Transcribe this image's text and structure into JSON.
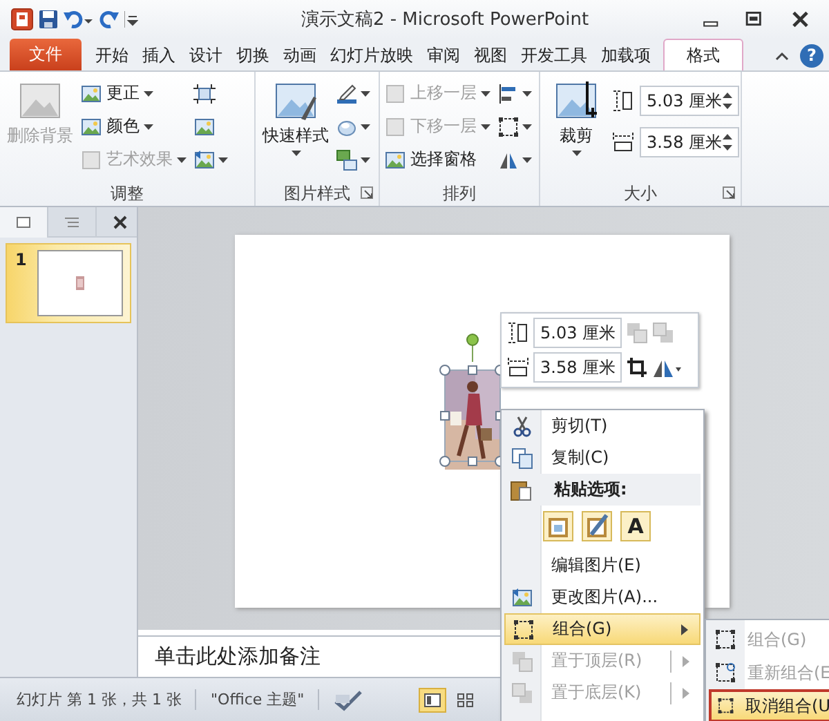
{
  "window": {
    "title": "演示文稿2  -  Microsoft PowerPoint"
  },
  "ribbon_tabs": [
    {
      "label": "文件",
      "kind": "file",
      "selected": false
    },
    {
      "label": "开始",
      "kind": "tab",
      "selected": false
    },
    {
      "label": "插入",
      "kind": "tab",
      "selected": false
    },
    {
      "label": "设计",
      "kind": "tab",
      "selected": false
    },
    {
      "label": "切换",
      "kind": "tab",
      "selected": false
    },
    {
      "label": "动画",
      "kind": "tab",
      "selected": false
    },
    {
      "label": "幻灯片放映",
      "kind": "tab",
      "selected": false
    },
    {
      "label": "审阅",
      "kind": "tab",
      "selected": false
    },
    {
      "label": "视图",
      "kind": "tab",
      "selected": false
    },
    {
      "label": "开发工具",
      "kind": "tab",
      "selected": false
    },
    {
      "label": "加载项",
      "kind": "tab",
      "selected": false
    },
    {
      "label": "格式",
      "kind": "tab",
      "selected": true
    }
  ],
  "help": {
    "label": "?"
  },
  "ribbon_groups": [
    {
      "label": "调整",
      "launcher": false,
      "buttons": [
        {
          "kind": "large",
          "label": "删除背景",
          "disabled": true,
          "dropdown": false
        },
        {
          "kind": "small",
          "label": "更正",
          "disabled": false,
          "dropdown": true
        },
        {
          "kind": "small",
          "label": "颜色",
          "disabled": false,
          "dropdown": true
        },
        {
          "kind": "small",
          "label": "艺术效果",
          "disabled": true,
          "dropdown": true
        },
        {
          "kind": "icon",
          "disabled": false,
          "dropdown": false
        },
        {
          "kind": "icon",
          "disabled": false,
          "dropdown": false
        },
        {
          "kind": "icon",
          "disabled": false,
          "dropdown": true
        }
      ]
    },
    {
      "label": "图片样式",
      "launcher": true,
      "buttons": [
        {
          "kind": "large",
          "label": "快速样式",
          "disabled": false,
          "dropdown": true
        },
        {
          "kind": "icon",
          "disabled": false,
          "dropdown": true
        },
        {
          "kind": "icon",
          "disabled": false,
          "dropdown": true
        },
        {
          "kind": "icon",
          "disabled": false,
          "dropdown": true
        }
      ]
    },
    {
      "label": "排列",
      "launcher": false,
      "buttons": [
        {
          "kind": "small",
          "label": "上移一层",
          "disabled": true,
          "dropdown": true
        },
        {
          "kind": "small",
          "label": "下移一层",
          "disabled": true,
          "dropdown": true
        },
        {
          "kind": "small",
          "label": "选择窗格",
          "disabled": false,
          "dropdown": false
        },
        {
          "kind": "icon",
          "disabled": false,
          "dropdown": true
        },
        {
          "kind": "icon",
          "disabled": false,
          "dropdown": true
        },
        {
          "kind": "icon",
          "disabled": false,
          "dropdown": true
        }
      ]
    },
    {
      "label": "大小",
      "launcher": true,
      "buttons": [
        {
          "kind": "large",
          "label": "裁剪",
          "disabled": false,
          "dropdown": true
        },
        {
          "kind": "spinner",
          "value": "5.03 厘米"
        },
        {
          "kind": "spinner",
          "value": "3.58 厘米"
        }
      ]
    }
  ],
  "slide_panel": {
    "tabs": [
      {
        "kind": "slides",
        "selected": true
      },
      {
        "kind": "outline",
        "selected": false
      }
    ],
    "thumbnails": [
      {
        "number": "1",
        "selected": true
      }
    ]
  },
  "notes": {
    "placeholder": "单击此处添加备注"
  },
  "mini_toolbar": {
    "fields": [
      {
        "value": "5.03 厘米"
      },
      {
        "value": "3.58 厘米"
      }
    ]
  },
  "context_menu": {
    "items": [
      {
        "kind": "item",
        "label": "剪切(T)",
        "disabled": false,
        "selected": false,
        "submenu": false,
        "split": false
      },
      {
        "kind": "item",
        "label": "复制(C)",
        "disabled": false,
        "selected": false,
        "submenu": false,
        "split": false
      },
      {
        "kind": "header",
        "label": "粘贴选项:"
      },
      {
        "kind": "paste_options",
        "options": [
          {
            "kind": "picture"
          },
          {
            "kind": "format"
          },
          {
            "kind": "text",
            "label": "A"
          }
        ]
      },
      {
        "kind": "item",
        "label": "编辑图片(E)",
        "disabled": false,
        "selected": false,
        "submenu": false,
        "split": false
      },
      {
        "kind": "item",
        "label": "更改图片(A)...",
        "disabled": false,
        "selected": false,
        "submenu": false,
        "split": false
      },
      {
        "kind": "item",
        "label": "组合(G)",
        "disabled": false,
        "selected": true,
        "submenu": true,
        "split": false
      },
      {
        "kind": "item",
        "label": "置于顶层(R)",
        "disabled": true,
        "selected": false,
        "submenu": true,
        "split": true
      },
      {
        "kind": "item",
        "label": "置于底层(K)",
        "disabled": true,
        "selected": false,
        "submenu": true,
        "split": true
      }
    ]
  },
  "submenu": {
    "items": [
      {
        "label": "组合(G)",
        "disabled": true,
        "selected": false
      },
      {
        "label": "重新组合(E",
        "disabled": true,
        "selected": false
      },
      {
        "label": "取消组合(U",
        "disabled": false,
        "selected": true
      }
    ]
  },
  "status_bar": {
    "slide_info": "幻灯片 第 1 张，共 1 张",
    "theme": "\"Office 主题\"",
    "views": [
      {
        "kind": "normal",
        "selected": true
      },
      {
        "kind": "sorter",
        "selected": false
      }
    ]
  }
}
